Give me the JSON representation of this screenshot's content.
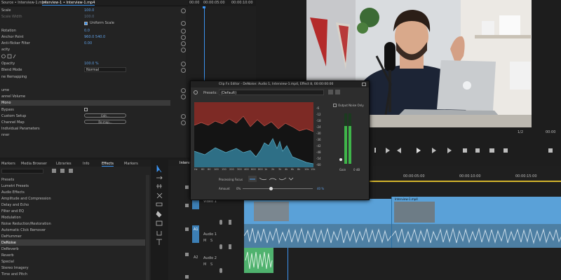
{
  "effect_controls": {
    "source_tab": "Source • Interview-1.mp4",
    "clip_tab": "Interview-1 • Interview-1.mp4",
    "timecodes": [
      "00:00",
      "00:00:05:00",
      "00:00:10:00"
    ],
    "rows": [
      {
        "label": "Scale",
        "value": "100.0"
      },
      {
        "label": "Scale Width",
        "value": "100.0"
      },
      {
        "label": "",
        "value": "Uniform Scale"
      },
      {
        "label": "Rotation",
        "value": "0.0"
      },
      {
        "label": "Anchor Point",
        "value": "960.0     540.0"
      },
      {
        "label": "Anti-flicker Filter",
        "value": "0.00"
      },
      {
        "label": "acity",
        "value": ""
      },
      {
        "label": "",
        "value": ""
      },
      {
        "label": "Opacity",
        "value": "100.0 %"
      },
      {
        "label": "Blend Mode",
        "value": "Normal"
      },
      {
        "label": "ne Remapping",
        "value": ""
      }
    ],
    "audio_rows": [
      {
        "label": "ume",
        "value": ""
      },
      {
        "label": "annel Volume",
        "value": ""
      },
      {
        "label": "Mono",
        "value": ""
      },
      {
        "label": "Bypass",
        "value": ""
      },
      {
        "label": "Custom Setup",
        "value": "Edit..."
      },
      {
        "label": "Channel Map",
        "value": "Re-map..."
      },
      {
        "label": "Individual Parameters",
        "value": ""
      },
      {
        "label": "nner",
        "value": ""
      }
    ]
  },
  "fx_editor": {
    "title": "Clip Fx Editor - DeNoise: Audio 1, Interview-1.mp4, Effect 8, 00:00:00:00",
    "presets_label": "Presets:",
    "preset_value": "(Default)",
    "output_noise_label": "Output Noise Only",
    "db_ticks": [
      "-6",
      "-12",
      "-18",
      "-24",
      "-30",
      "-36",
      "-42",
      "-48",
      "-54",
      "-60"
    ],
    "freq_ticks": [
      "Hz",
      "60",
      "80",
      "100",
      "150",
      "200",
      "300",
      "400",
      "600",
      "800",
      "1k",
      "2k",
      "3k",
      "4k",
      "6k",
      "8k",
      "10k",
      "15k"
    ],
    "processing_focus_label": "Processing Focus",
    "amount_label": "Amount",
    "amount_min": "0%",
    "amount_value": "40 %",
    "gain_label": "Gain",
    "gain_value": "0 dB",
    "amount_fraction": 0.4
  },
  "effects_panel": {
    "tabs": [
      "Markers",
      "Media Browser",
      "Libraries",
      "Info",
      "Effects",
      "Markers"
    ],
    "items": [
      {
        "label": "Presets",
        "highlight": false
      },
      {
        "label": "Lumetri Presets",
        "highlight": false
      },
      {
        "label": "Audio Effects",
        "highlight": false
      },
      {
        "label": "Amplitude and Compression",
        "highlight": false
      },
      {
        "label": "Delay and Echo",
        "highlight": false
      },
      {
        "label": "Filter and EQ",
        "highlight": false
      },
      {
        "label": "Modulation",
        "highlight": false
      },
      {
        "label": "Noise Reduction/Restoration",
        "highlight": false
      },
      {
        "label": "Automatic Click Remover",
        "highlight": false
      },
      {
        "label": "DeHummer",
        "highlight": false
      },
      {
        "label": "DeNoise",
        "highlight": true
      },
      {
        "label": "DeReverb",
        "highlight": false
      },
      {
        "label": "Reverb",
        "highlight": false
      },
      {
        "label": "Special",
        "highlight": false
      },
      {
        "label": "Stereo Imagery",
        "highlight": false
      },
      {
        "label": "Time and Pitch",
        "highlight": false
      }
    ]
  },
  "program_monitor": {
    "zoom": "1/2",
    "timecode": "00:00",
    "end_timecode": "00:00"
  },
  "timeline": {
    "tab": "Interview",
    "ruler": [
      "00:00:05:00",
      "00:00:10:00",
      "00:00:15:00"
    ],
    "clip1_name": "Interview-1.mp4",
    "clip2_name": "Interview-1.mp4",
    "tracks": [
      {
        "id": "V1",
        "name": "Video 1"
      },
      {
        "id": "A1",
        "name": "Audio 1"
      },
      {
        "id": "A2",
        "name": "Audio 2"
      }
    ],
    "source_patch": "A1  L, R  Out: L, R",
    "marks": [
      "M",
      "S",
      "M",
      "S"
    ]
  },
  "colors": {
    "accent": "#3b93f0",
    "clip_blue": "#5aa1d8",
    "audio_clip": "#4d7fa3",
    "spectrum_red": "#7d2a25",
    "spectrum_blue": "#2e6f86"
  }
}
